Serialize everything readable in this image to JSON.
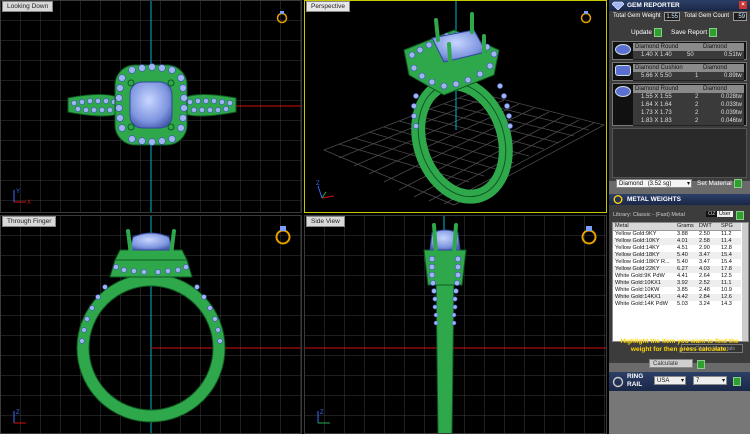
{
  "viewports": {
    "top_left": {
      "label": "Looking Down"
    },
    "top_right": {
      "label": "Perspective"
    },
    "bottom_left": {
      "label": "Through Finger"
    },
    "bottom_right": {
      "label": "Side View"
    }
  },
  "axis": {
    "x": "X",
    "y": "Y",
    "z": "Z"
  },
  "gem_reporter": {
    "title": "GEM REPORTER",
    "total_weight_label": "Total Gem Weight",
    "total_weight_value": "1.55",
    "total_count_label": "Total Gem Count",
    "total_count_value": "59",
    "update_label": "Update",
    "save_report_label": "Save Report",
    "groups": [
      {
        "rows": [
          {
            "a": "Diamond Round",
            "b": "",
            "c": "Diamond"
          },
          {
            "a": "1.40 X 1.40",
            "b": "50",
            "c": "0.51tw"
          }
        ]
      },
      {
        "rows": [
          {
            "a": "Diamond Cushion",
            "b": "",
            "c": "Diamond"
          },
          {
            "a": "5.66 X 5.50",
            "b": "1",
            "c": "0.89tw"
          }
        ]
      },
      {
        "rows": [
          {
            "a": "Diamond Round",
            "b": "",
            "c": "Diamond"
          },
          {
            "a": "1.55 X 1.55",
            "b": "2",
            "c": "0.028tw"
          },
          {
            "a": "1.64 X 1.64",
            "b": "2",
            "c": "0.033tw"
          },
          {
            "a": "1.73 X 1.73",
            "b": "2",
            "c": "0.039tw"
          },
          {
            "a": "1.83 X 1.83",
            "b": "2",
            "c": "0.046tw"
          }
        ]
      }
    ],
    "material_select": "Diamond",
    "material_sg": "(3.52 sg)",
    "set_material_label": "Set Material"
  },
  "metal_weights": {
    "title": "METAL WEIGHTS",
    "library_label": "Library: Classic - (Fast) Metal",
    "library_unit": "User",
    "library_unit_prefix": "OZ",
    "columns": [
      "Metal",
      "Grams",
      "DWT",
      "SPG"
    ],
    "rows": [
      [
        "Yellow Gold:9KY",
        "3.88",
        "2.50",
        "11.2"
      ],
      [
        "Yellow Gold:10KY",
        "4.01",
        "2.58",
        "11.4"
      ],
      [
        "Yellow Gold:14KY",
        "4.51",
        "2.90",
        "12.8"
      ],
      [
        "Yellow Gold:18KY",
        "5.40",
        "3.47",
        "15.4"
      ],
      [
        "Yellow Gold:18KY R...",
        "5.40",
        "3.47",
        "15.4"
      ],
      [
        "Yellow Gold:22KY",
        "6.27",
        "4.03",
        "17.8"
      ],
      [
        "White Gold:9K PdW",
        "4.41",
        "2.64",
        "12.5"
      ],
      [
        "White Gold:10KX1",
        "3.92",
        "2.52",
        "11.1"
      ],
      [
        "White Gold:10KW",
        "3.85",
        "2.48",
        "10.9"
      ],
      [
        "White Gold:14KX1",
        "4.42",
        "2.84",
        "12.6"
      ],
      [
        "White Gold:14K PdW",
        "5.03",
        "3.24",
        "14.3"
      ]
    ],
    "use_object_materials": "Use Object Materials",
    "message": "Highlight the item you want to find the weight for then press calculate.",
    "calculate_label": "Calculate"
  },
  "ring_rail": {
    "title_line1": "RING",
    "title_line2": "RAIL",
    "region": "USA",
    "size": "7"
  },
  "colors": {
    "metal": "#2ea84a",
    "gem": "#9fb4f0",
    "grid": "#3d3d3d",
    "red_axis": "#d01010",
    "cyan_axis": "#00b8c8",
    "active_border": "#c8c800"
  }
}
